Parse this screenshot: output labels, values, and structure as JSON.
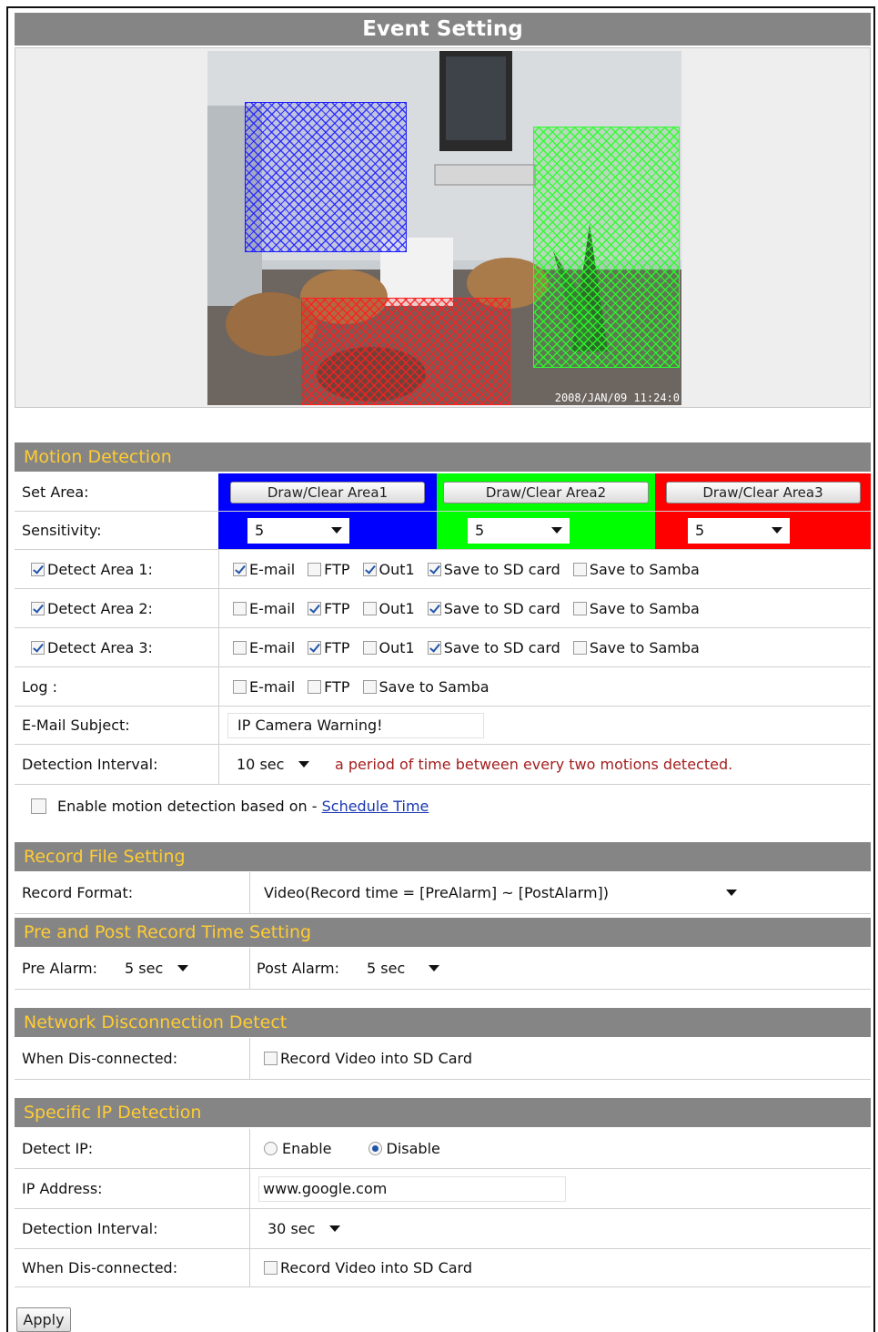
{
  "header": {
    "title": "Event Setting"
  },
  "preview": {
    "timestamp": "2008/JAN/09 11:24:0"
  },
  "motion": {
    "section_title": "Motion Detection",
    "set_area_label": "Set Area:",
    "area_buttons": [
      "Draw/Clear Area1",
      "Draw/Clear Area2",
      "Draw/Clear Area3"
    ],
    "area_colors": [
      "#0000ff",
      "#00ff00",
      "#ff0000"
    ],
    "sensitivity_label": "Sensitivity:",
    "sensitivity_values": [
      "5",
      "5",
      "5"
    ],
    "detect_rows": [
      {
        "label": "Detect Area 1:",
        "checked": true,
        "email": true,
        "ftp": false,
        "out1": true,
        "sd": true,
        "samba": false
      },
      {
        "label": "Detect Area 2:",
        "checked": true,
        "email": false,
        "ftp": true,
        "out1": false,
        "sd": true,
        "samba": false
      },
      {
        "label": "Detect Area 3:",
        "checked": true,
        "email": false,
        "ftp": true,
        "out1": false,
        "sd": true,
        "samba": false
      }
    ],
    "opt_email": "E-mail",
    "opt_ftp": "FTP",
    "opt_out1": "Out1",
    "opt_sd": "Save to SD card",
    "opt_samba": "Save to Samba",
    "log_label": "Log :",
    "email_subject_label": "E-Mail Subject:",
    "email_subject_value": "IP Camera Warning!",
    "interval_label": "Detection Interval:",
    "interval_value": "10 sec",
    "interval_note": "a period of time between every two motions detected.",
    "schedule_text": "Enable motion detection based on - ",
    "schedule_link": "Schedule Time"
  },
  "record": {
    "section_title": "Record File Setting",
    "format_label": "Record Format:",
    "format_value": "Video(Record time = [PreAlarm] ~ [PostAlarm])"
  },
  "prepost": {
    "section_title": "Pre and Post Record Time Setting",
    "pre_label": "Pre Alarm:",
    "pre_value": "5 sec",
    "post_label": "Post Alarm:",
    "post_value": "5 sec"
  },
  "network": {
    "section_title": "Network Disconnection Detect",
    "when_label": "When Dis-connected:",
    "record_sd": "Record Video into SD Card"
  },
  "ipdetect": {
    "section_title": "Specific IP Detection",
    "detect_label": "Detect IP:",
    "enable": "Enable",
    "disable": "Disable",
    "ip_label": "IP Address:",
    "ip_value": "www.google.com",
    "interval_label": "Detection Interval:",
    "interval_value": "30 sec",
    "when_label": "When Dis-connected:",
    "record_sd": "Record Video into SD Card"
  },
  "apply_label": "Apply"
}
